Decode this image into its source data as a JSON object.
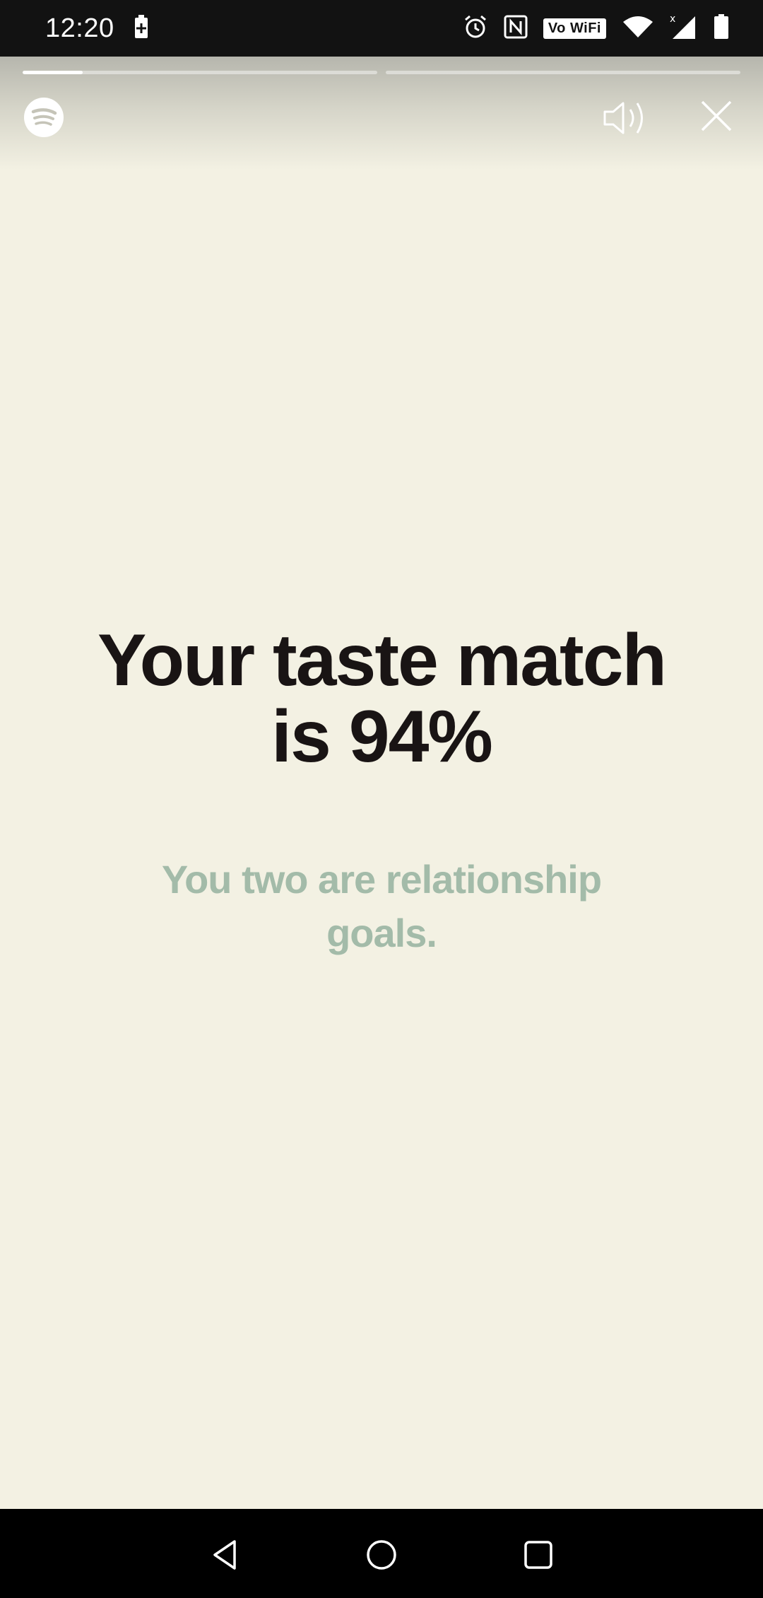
{
  "status_bar": {
    "time": "12:20",
    "wifi_badge": "Vo WiFi",
    "icons": [
      "battery-saver-icon",
      "alarm-icon",
      "nfc-icon",
      "wifi-icon",
      "signal-icon",
      "battery-icon"
    ]
  },
  "story": {
    "progress": [
      0.17,
      0.0
    ],
    "brand_icon": "spotify-icon",
    "sound_icon": "speaker-icon",
    "close_icon": "close-icon"
  },
  "main": {
    "headline_line1": "Your taste match",
    "headline_line2": "is 94%",
    "subline_line1": "You two are relationship",
    "subline_line2": "goals."
  },
  "nav": {
    "icons": [
      "back-icon",
      "home-icon",
      "recents-icon"
    ]
  },
  "colors": {
    "background": "#f3f1e3",
    "headline": "#191414",
    "subline": "#a3bba9"
  }
}
